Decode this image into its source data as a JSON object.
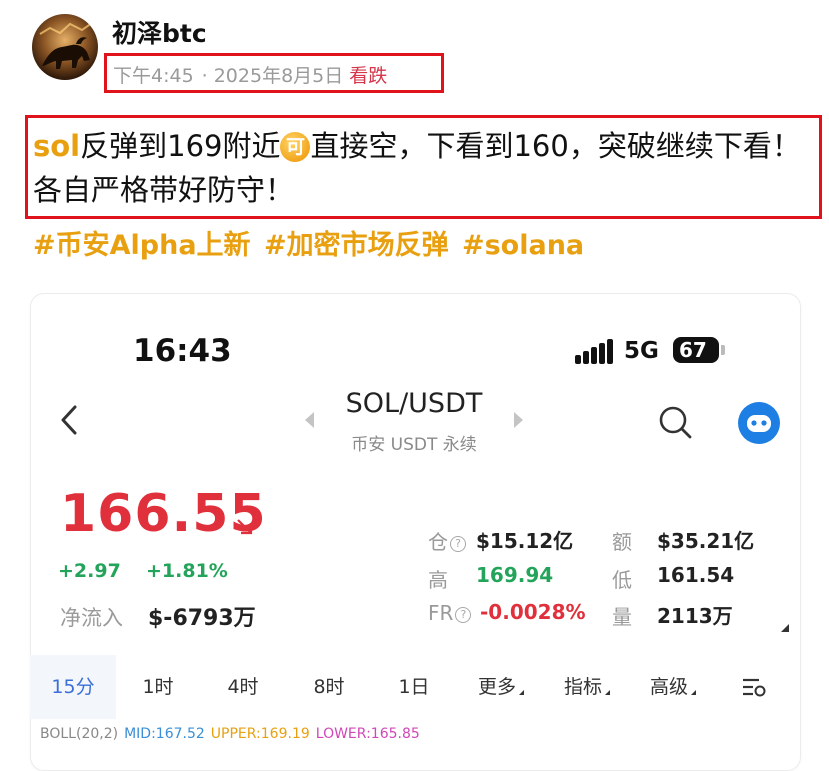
{
  "post": {
    "author": "初泽btc",
    "time": "下午4:45",
    "dot": "·",
    "date": "2025年8月5日",
    "tag": "看跌",
    "body_keyword": "sol",
    "body_part1": "反弹到169附近",
    "emoji_label": "可",
    "body_part2": "直接空，下看到160，突破继续下看！各自严格带好防守！",
    "hashtags": [
      "#币安Alpha上新",
      "#加密市场反弹",
      "#solana"
    ]
  },
  "phone": {
    "time": "16:43",
    "network": "5G",
    "battery": "67"
  },
  "market": {
    "pair": "SOL/USDT",
    "subtitle": "币安 USDT 永续",
    "price": "166.55",
    "change_abs": "+2.97",
    "change_pct": "+1.81%",
    "net_inflow_label": "净流入",
    "net_inflow_value": "$-6793万",
    "stats": {
      "position_label": "仓",
      "position_value": "$15.12亿",
      "amount_label": "额",
      "amount_value": "$35.21亿",
      "high_label": "高",
      "high_value": "169.94",
      "low_label": "低",
      "low_value": "161.54",
      "fr_label": "FR",
      "fr_value": "-0.0028%",
      "volume_label": "量",
      "volume_value": "2113万"
    }
  },
  "tabs": [
    "15分",
    "1时",
    "4时",
    "8时",
    "1日",
    "更多",
    "指标",
    "高级"
  ],
  "indicator": {
    "name": "BOLL(20,2)",
    "mid": "MID:167.52",
    "upper": "UPPER:169.19",
    "lower": "LOWER:165.85"
  },
  "colors": {
    "price_down_red": "#e0303c",
    "change_green": "#23a45a",
    "highlight_box_red": "#e0121b",
    "hashtag_gold": "#e8a010",
    "active_tab_blue": "#3a6fd8",
    "boll_mid": "#3a8fd6",
    "boll_upper": "#e8a010",
    "boll_lower": "#d048b8"
  },
  "icons": [
    "bull-avatar-icon",
    "cellular-signal-icon",
    "battery-icon",
    "back-chevron-icon",
    "prev-pair-icon",
    "next-pair-icon",
    "search-icon",
    "bot-avatar-icon",
    "down-right-arrow-icon",
    "info-circle-icon",
    "chart-settings-icon"
  ]
}
